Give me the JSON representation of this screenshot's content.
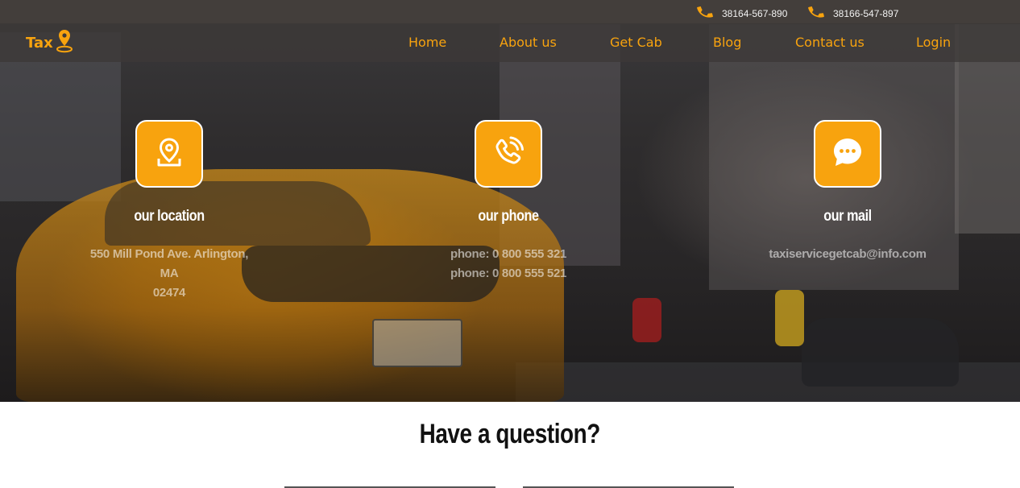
{
  "topbar": {
    "phones": [
      {
        "icon": "phone-icon",
        "number": "38164-567-890"
      },
      {
        "icon": "phone-icon",
        "number": "38166-547-897"
      }
    ]
  },
  "brand": {
    "name": "Tax",
    "icon": "map-pin-icon",
    "color": "#f8a30e"
  },
  "nav": {
    "items": [
      {
        "label": "Home"
      },
      {
        "label": "About us"
      },
      {
        "label": "Get Cab"
      },
      {
        "label": "Blog"
      },
      {
        "label": "Contact us"
      },
      {
        "label": "Login"
      }
    ]
  },
  "info": [
    {
      "icon": "location-icon",
      "title": "our location",
      "lines": [
        "550 Mill Pond Ave. Arlington, MA",
        "02474"
      ]
    },
    {
      "icon": "phone-call-icon",
      "title": "our phone",
      "lines": [
        "phone: 0 800 555 321",
        "phone: 0 800 555 521"
      ]
    },
    {
      "icon": "chat-icon",
      "title": "our mail",
      "lines": [
        "taxiservicegetcab@info.com"
      ]
    }
  ],
  "contact": {
    "heading": "Have a question?"
  },
  "colors": {
    "accent": "#f8a30e",
    "topbar": "#433e3b"
  }
}
